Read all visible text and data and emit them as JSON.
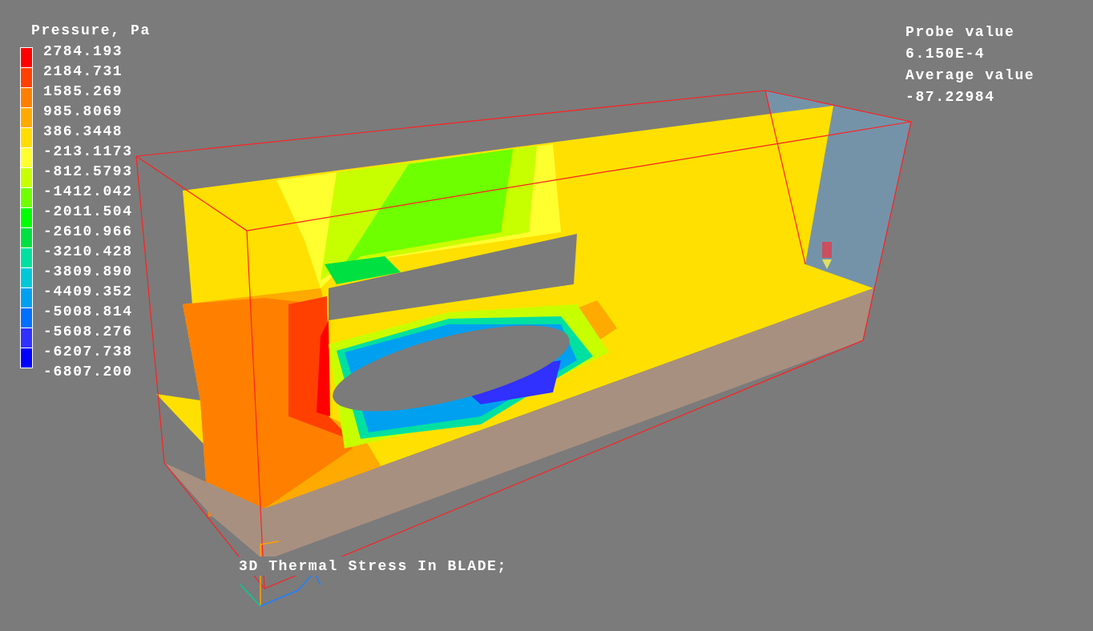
{
  "legend": {
    "title": "Pressure, Pa",
    "labels": [
      "2784.193",
      "2184.731",
      "1585.269",
      "985.8069",
      "386.3448",
      "-213.1173",
      "-812.5793",
      "-1412.042",
      "-2011.504",
      "-2610.966",
      "-3210.428",
      "-3809.890",
      "-4409.352",
      "-5008.814",
      "-5608.276",
      "-6207.738",
      "-6807.200"
    ],
    "swatches": [
      {
        "color": "#ff0000"
      },
      {
        "color": "#ff4000"
      },
      {
        "color": "#ff8000"
      },
      {
        "color": "#ffaa00"
      },
      {
        "color": "#ffdd00"
      },
      {
        "color": "#ffff30"
      },
      {
        "color": "#c8ff00"
      },
      {
        "color": "#6eff00"
      },
      {
        "color": "#00ff00"
      },
      {
        "color": "#00e040"
      },
      {
        "color": "#00e0a0"
      },
      {
        "color": "#00c8d8"
      },
      {
        "color": "#00a0f0"
      },
      {
        "color": "#0070ff"
      },
      {
        "color": "#3030ff"
      },
      {
        "color": "#0000ff"
      }
    ]
  },
  "probe": {
    "probe_label": "Probe value",
    "probe_value": "6.150E-4",
    "average_label": "Average value",
    "average_value": "-87.22984"
  },
  "caption": "3D Thermal Stress In BLADE;"
}
